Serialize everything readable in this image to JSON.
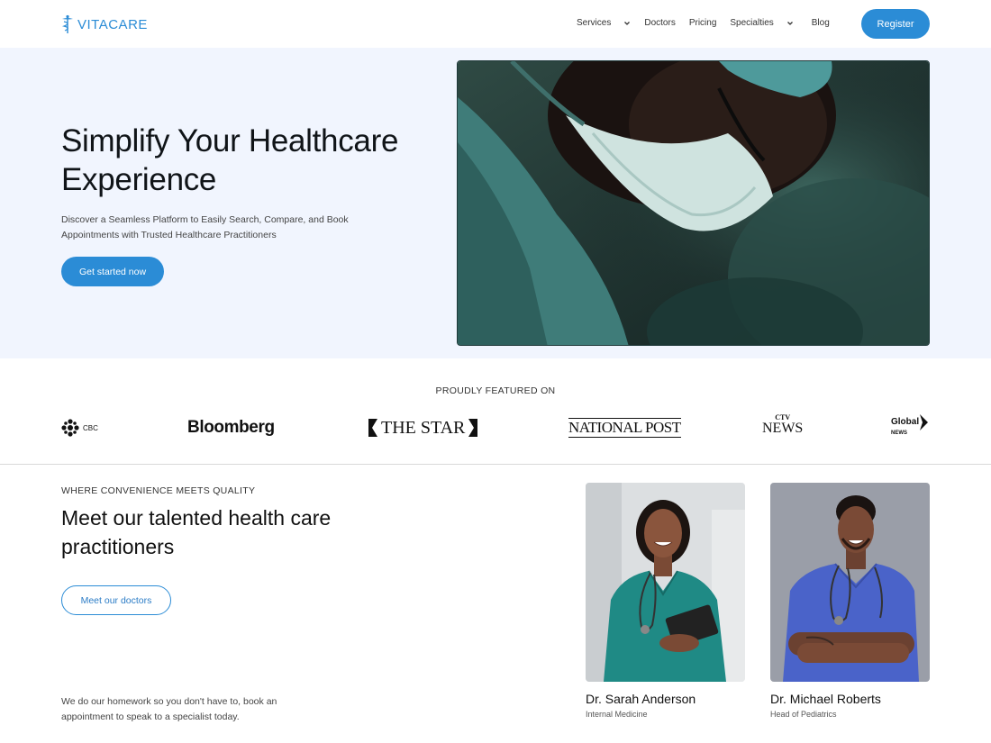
{
  "brand": {
    "name": "VITACARE",
    "color": "#2b8cd6"
  },
  "nav": {
    "items": [
      {
        "label": "Services",
        "has_dropdown": true
      },
      {
        "label": "Doctors",
        "has_dropdown": false
      },
      {
        "label": "Pricing",
        "has_dropdown": false
      },
      {
        "label": "Specialties",
        "has_dropdown": true
      },
      {
        "label": "Blog",
        "has_dropdown": false
      }
    ],
    "register_label": "Register"
  },
  "hero": {
    "title": "Simplify Your Healthcare Experience",
    "subtitle": "Discover a Seamless Platform to Easily Search, Compare, and Book Appointments with Trusted Healthcare Practitioners",
    "cta_label": "Get started now",
    "background": "#f1f5fe"
  },
  "featured": {
    "title": "PROUDLY FEATURED ON",
    "logos": {
      "cbc": "CBC",
      "bloomberg": "Bloomberg",
      "star": "THE STAR",
      "national_post": "NATIONAL POST",
      "ctv_top": "CTV",
      "ctv_bottom": "NEWS",
      "global_top": "Global",
      "global_bottom": "NEWS"
    }
  },
  "doctors_section": {
    "eyebrow": "WHERE CONVENIENCE MEETS QUALITY",
    "title": "Meet our talented health care practitioners",
    "button_label": "Meet our doctors",
    "note": "We do our homework so you don't have to, book an appointment to speak to a specialist today.",
    "doctors": [
      {
        "name": "Dr. Sarah Anderson",
        "role": "Internal Medicine",
        "scrub_color": "#1f8a85"
      },
      {
        "name": "Dr. Michael Roberts",
        "role": "Head of Pediatrics",
        "scrub_color": "#4a63c9"
      }
    ]
  }
}
